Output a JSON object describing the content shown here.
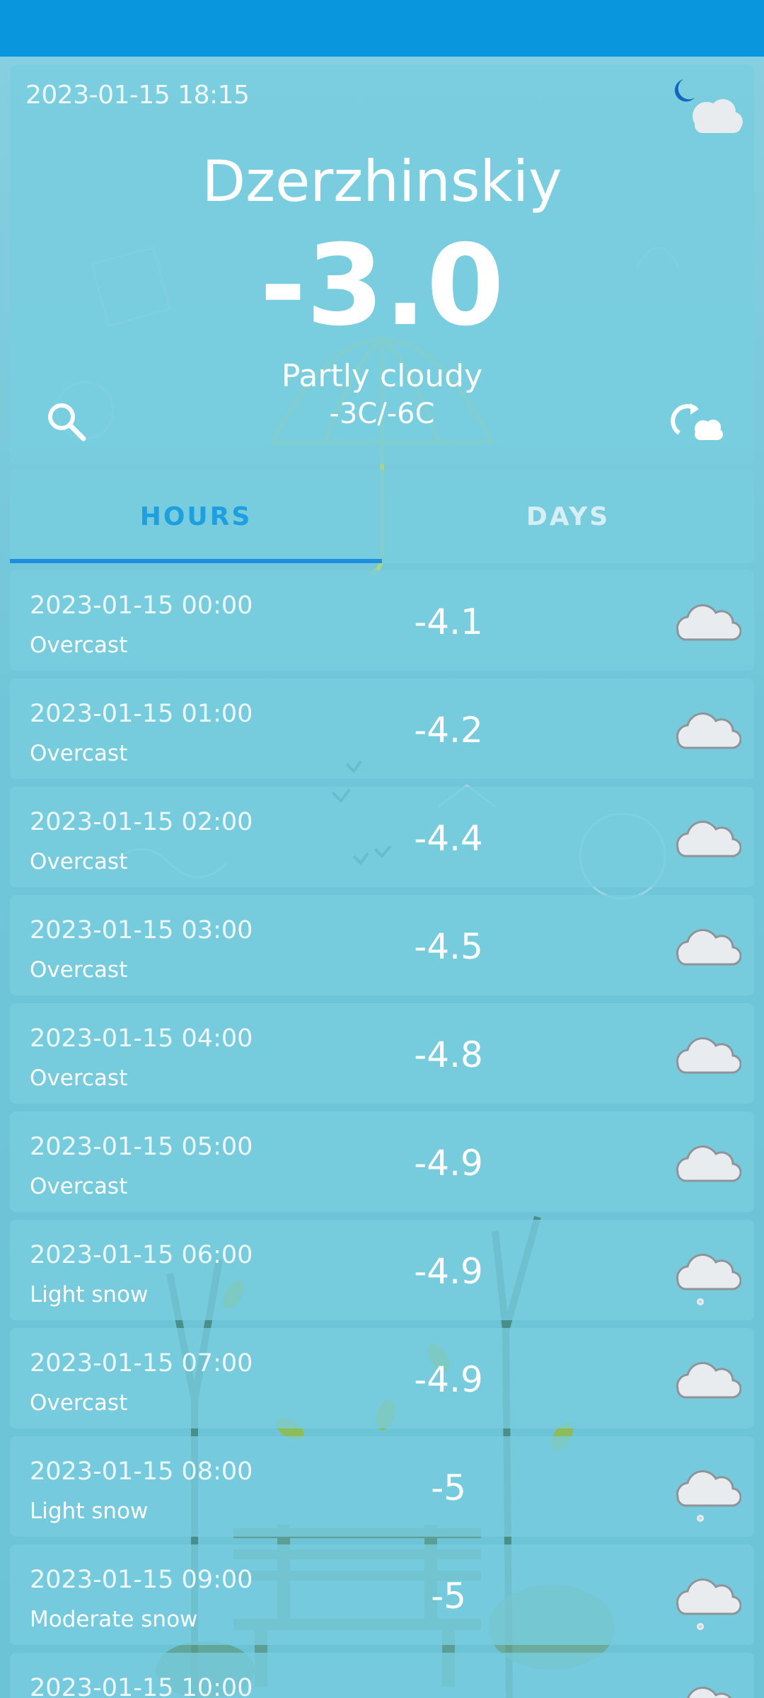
{
  "current": {
    "datetime": "2023-01-15 18:15",
    "icon": "night-partly-cloudy-icon",
    "city": "Dzerzhinskiy",
    "temperature": "-3.0",
    "condition": "Partly cloudy",
    "range": "-3C/-6C"
  },
  "controls": {
    "search_icon": "search-icon",
    "refresh_icon": "refresh-weather-icon"
  },
  "tabs": [
    {
      "label": "HOURS",
      "active": true
    },
    {
      "label": "DAYS",
      "active": false
    }
  ],
  "hours": [
    {
      "time": "2023-01-15 00:00",
      "condition": "Overcast",
      "temp": "-4.1",
      "icon": "cloud-icon"
    },
    {
      "time": "2023-01-15 01:00",
      "condition": "Overcast",
      "temp": "-4.2",
      "icon": "cloud-icon"
    },
    {
      "time": "2023-01-15 02:00",
      "condition": "Overcast",
      "temp": "-4.4",
      "icon": "cloud-icon"
    },
    {
      "time": "2023-01-15 03:00",
      "condition": "Overcast",
      "temp": "-4.5",
      "icon": "cloud-icon"
    },
    {
      "time": "2023-01-15 04:00",
      "condition": "Overcast",
      "temp": "-4.8",
      "icon": "cloud-icon"
    },
    {
      "time": "2023-01-15 05:00",
      "condition": "Overcast",
      "temp": "-4.9",
      "icon": "cloud-icon"
    },
    {
      "time": "2023-01-15 06:00",
      "condition": "Light snow",
      "temp": "-4.9",
      "icon": "snow-cloud-icon"
    },
    {
      "time": "2023-01-15 07:00",
      "condition": "Overcast",
      "temp": "-4.9",
      "icon": "cloud-icon"
    },
    {
      "time": "2023-01-15 08:00",
      "condition": "Light snow",
      "temp": "-5",
      "icon": "snow-cloud-icon"
    },
    {
      "time": "2023-01-15 09:00",
      "condition": "Moderate snow",
      "temp": "-5",
      "icon": "snow-cloud-icon"
    },
    {
      "time": "2023-01-15 10:00",
      "condition": "",
      "temp": "",
      "icon": "cloud-icon"
    }
  ],
  "colors": {
    "status_bar": "#0a96dc",
    "accent": "#1e9fe0",
    "card": "#78cdde"
  }
}
